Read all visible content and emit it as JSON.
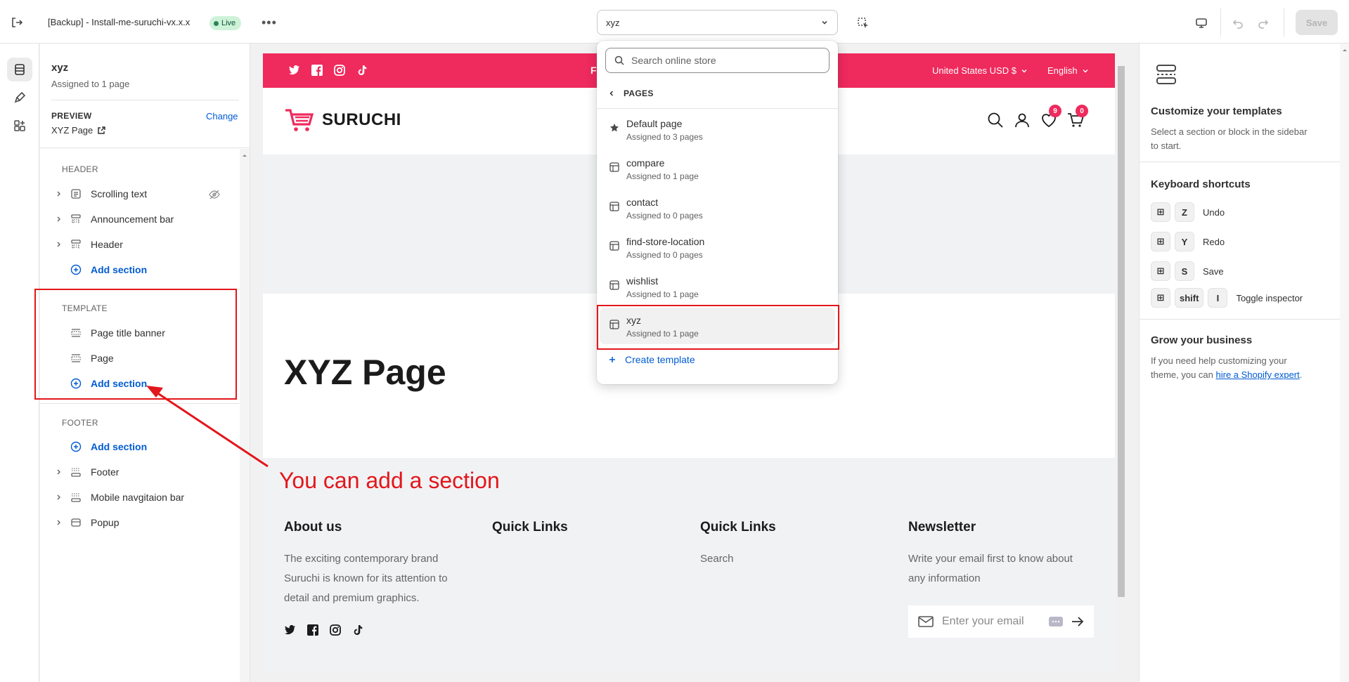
{
  "topbar": {
    "store_title": "[Backup] - Install-me-suruchi-vx.x.x",
    "live_badge": "Live",
    "more": "•••",
    "template_select": "xyz",
    "save_label": "Save"
  },
  "sidebar": {
    "template_name": "xyz",
    "template_sub": "Assigned to 1 page",
    "preview_label": "PREVIEW",
    "change_label": "Change",
    "preview_value": "XYZ Page",
    "header_group": "HEADER",
    "header_items": [
      {
        "label": "Scrolling text",
        "icon": "text-lines-icon"
      },
      {
        "label": "Announcement bar",
        "icon": "section-top-icon"
      },
      {
        "label": "Header",
        "icon": "section-top-icon"
      }
    ],
    "add_section": "Add section",
    "template_group": "TEMPLATE",
    "template_items": [
      {
        "label": "Page title banner",
        "icon": "section-icon"
      },
      {
        "label": "Page",
        "icon": "section-icon"
      }
    ],
    "footer_group": "FOOTER",
    "footer_items": [
      {
        "label": "Footer",
        "icon": "section-bottom-icon"
      },
      {
        "label": "Mobile navgitaion bar",
        "icon": "section-bottom-icon"
      },
      {
        "label": "Popup",
        "icon": "popup-icon"
      }
    ]
  },
  "dropdown": {
    "search_placeholder": "Search online store",
    "back_label": "PAGES",
    "items": [
      {
        "name": "Default page",
        "sub": "Assigned to 3 pages",
        "icon": "star-icon"
      },
      {
        "name": "compare",
        "sub": "Assigned to 1 page",
        "icon": "template-icon"
      },
      {
        "name": "contact",
        "sub": "Assigned to 0 pages",
        "icon": "template-icon"
      },
      {
        "name": "find-store-location",
        "sub": "Assigned to 0 pages",
        "icon": "template-icon"
      },
      {
        "name": "wishlist",
        "sub": "Assigned to 1 page",
        "icon": "template-icon"
      },
      {
        "name": "xyz",
        "sub": "Assigned to 1 page",
        "icon": "template-icon"
      }
    ],
    "create_label": "Create template"
  },
  "store": {
    "announce_text": "F",
    "currency": "United States USD $",
    "language": "English",
    "logo_text": "SURUCHI",
    "wishlist_count": "9",
    "cart_count": "0",
    "page_title": "XYZ Page",
    "footer": {
      "about_heading": "About us",
      "about_text": "The exciting contemporary brand Suruchi is known for its attention to detail and premium graphics.",
      "quick1_heading": "Quick Links",
      "quick2_heading": "Quick Links",
      "quick2_link": "Search",
      "news_heading": "Newsletter",
      "news_text": "Write your email first to know about any information",
      "email_placeholder": "Enter your email"
    }
  },
  "annotation": {
    "callout": "You can add a section"
  },
  "rpanel": {
    "heading": "Customize your templates",
    "text": "Select a section or block in the sidebar to start.",
    "shortcuts_heading": "Keyboard shortcuts",
    "shortcuts": [
      {
        "keys": [
          "⊞",
          "Z"
        ],
        "label": "Undo"
      },
      {
        "keys": [
          "⊞",
          "Y"
        ],
        "label": "Redo"
      },
      {
        "keys": [
          "⊞",
          "S"
        ],
        "label": "Save"
      },
      {
        "keys": [
          "⊞",
          "shift",
          "I"
        ],
        "label": "Toggle inspector"
      }
    ],
    "grow_heading": "Grow your business",
    "grow_text_pre": "If you need help customizing your theme, you can ",
    "grow_link": "hire a Shopify expert",
    "grow_text_post": "."
  },
  "colors": {
    "accent_red": "#e3161b",
    "brand_pink": "#ef2a5d",
    "link_blue": "#005bd3"
  }
}
